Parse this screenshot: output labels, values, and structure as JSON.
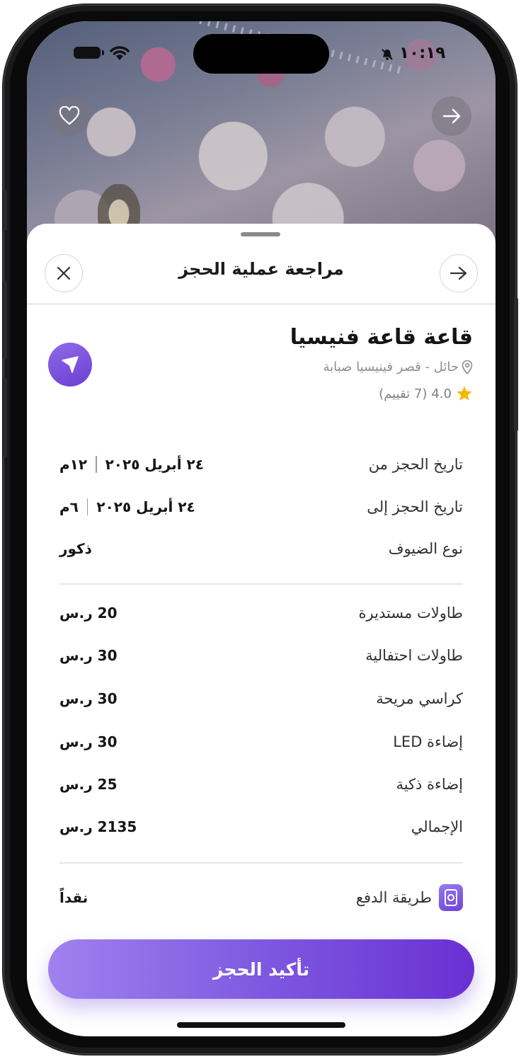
{
  "status_bar": {
    "time": "١٠:١٩"
  },
  "sheet": {
    "title": "مراجعة عملية الحجز",
    "venue": {
      "name": "قاعة قاعة فنيسيا",
      "location": "حائل - قصر فينيسيا صبابة",
      "rating": "4.0",
      "reviews": "(7 تقييم)"
    },
    "booking": [
      {
        "label": "تاريخ الحجز من",
        "date": "٢٤ أبريل ٢٠٢٥",
        "time": "١٢م"
      },
      {
        "label": "تاريخ الحجز إلى",
        "date": "٢٤ أبريل ٢٠٢٥",
        "time": "٦م"
      },
      {
        "label": "نوع الضيوف",
        "value": "ذكور"
      }
    ],
    "items": [
      {
        "label": "طاولات مستديرة",
        "price": "20 ر.س"
      },
      {
        "label": "طاولات احتفالية",
        "price": "30 ر.س"
      },
      {
        "label": "كراسي مريحة",
        "price": "30 ر.س"
      },
      {
        "label": "إضاءة LED",
        "price": "30 ر.س"
      },
      {
        "label": "إضاءة ذكية",
        "price": "25 ر.س"
      },
      {
        "label": "الإجمالي",
        "price": "2135 ر.س"
      }
    ],
    "payment": {
      "label": "طريقة الدفع",
      "value": "نقداً"
    },
    "confirm_label": "تأكيد الحجز"
  },
  "colors": {
    "accent": "#6a2fd3",
    "accent_light": "#9f82ef",
    "star": "#f5b800"
  },
  "icons": [
    "heart-icon",
    "share-arrow-icon",
    "close-icon",
    "back-arrow-icon",
    "navigation-icon",
    "location-pin-icon",
    "star-icon",
    "payment-icon",
    "bell-slash-icon",
    "wifi-icon",
    "battery-icon"
  ]
}
